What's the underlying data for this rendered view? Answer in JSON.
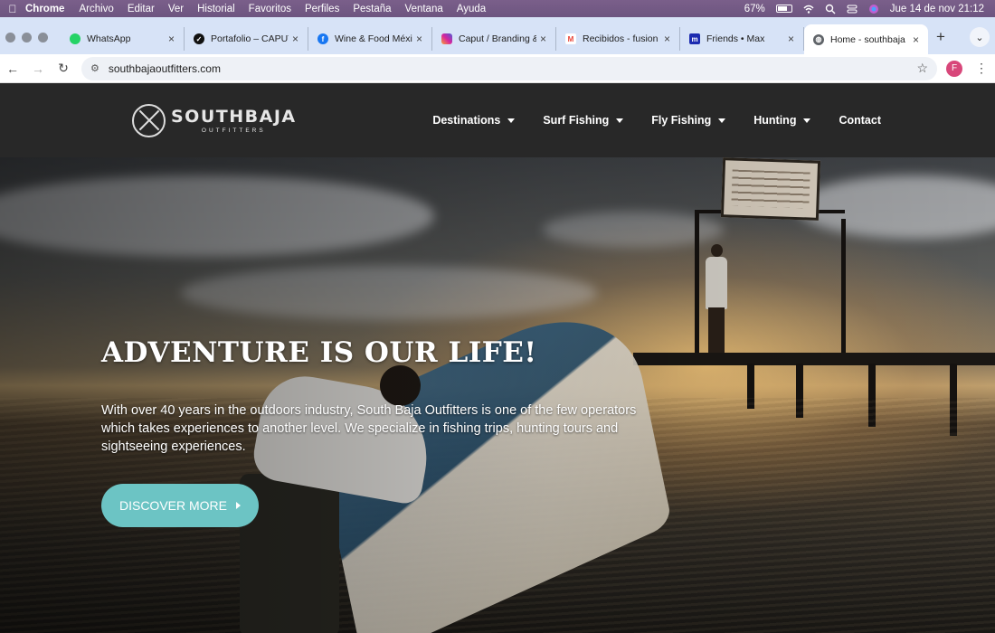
{
  "menubar": {
    "app_name": "Chrome",
    "menus": [
      "Archivo",
      "Editar",
      "Ver",
      "Historial",
      "Favoritos",
      "Perfiles",
      "Pestaña",
      "Ventana",
      "Ayuda"
    ],
    "battery": "67%",
    "datetime": "Jue 14 de nov  21:12"
  },
  "tabs": [
    {
      "title": "WhatsApp",
      "icon": "whatsapp-icon",
      "color": "#25d366",
      "active": false
    },
    {
      "title": "Portafolio – CAPUT",
      "icon": "portfolio-icon",
      "color": "#111111",
      "active": false
    },
    {
      "title": "Wine & Food México",
      "icon": "facebook-icon",
      "color": "#1877f2",
      "active": false
    },
    {
      "title": "Caput / Branding &",
      "icon": "instagram-icon",
      "color": "#d6249f",
      "active": false
    },
    {
      "title": "Recibidos - fusion",
      "icon": "gmail-icon",
      "color": "#ea4335",
      "active": false
    },
    {
      "title": "Friends • Max",
      "icon": "max-icon",
      "color": "#1c2bb0",
      "active": false
    },
    {
      "title": "Home - southbaja",
      "icon": "globe-icon",
      "color": "#5f6368",
      "active": true
    }
  ],
  "toolbar": {
    "url": "southbajaoutfitters.com",
    "profile_initial": "F"
  },
  "site": {
    "logo_name": "SOUTHBAJA",
    "logo_sub": "OUTFITTERS",
    "nav": [
      {
        "label": "Destinations",
        "dropdown": true
      },
      {
        "label": "Surf Fishing",
        "dropdown": true
      },
      {
        "label": "Fly Fishing",
        "dropdown": true
      },
      {
        "label": "Hunting",
        "dropdown": true
      },
      {
        "label": "Contact",
        "dropdown": false
      }
    ]
  },
  "hero": {
    "title": "ADVENTURE IS OUR LIFE!",
    "text": "With over 40 years in the outdoors industry, South Baja Outfitters is one of the few operators which takes experiences to another level. We specialize in fishing trips, hunting tours and sightseeing experiences.",
    "cta_label": "DISCOVER MORE",
    "cta_color": "#6cc4c4"
  }
}
